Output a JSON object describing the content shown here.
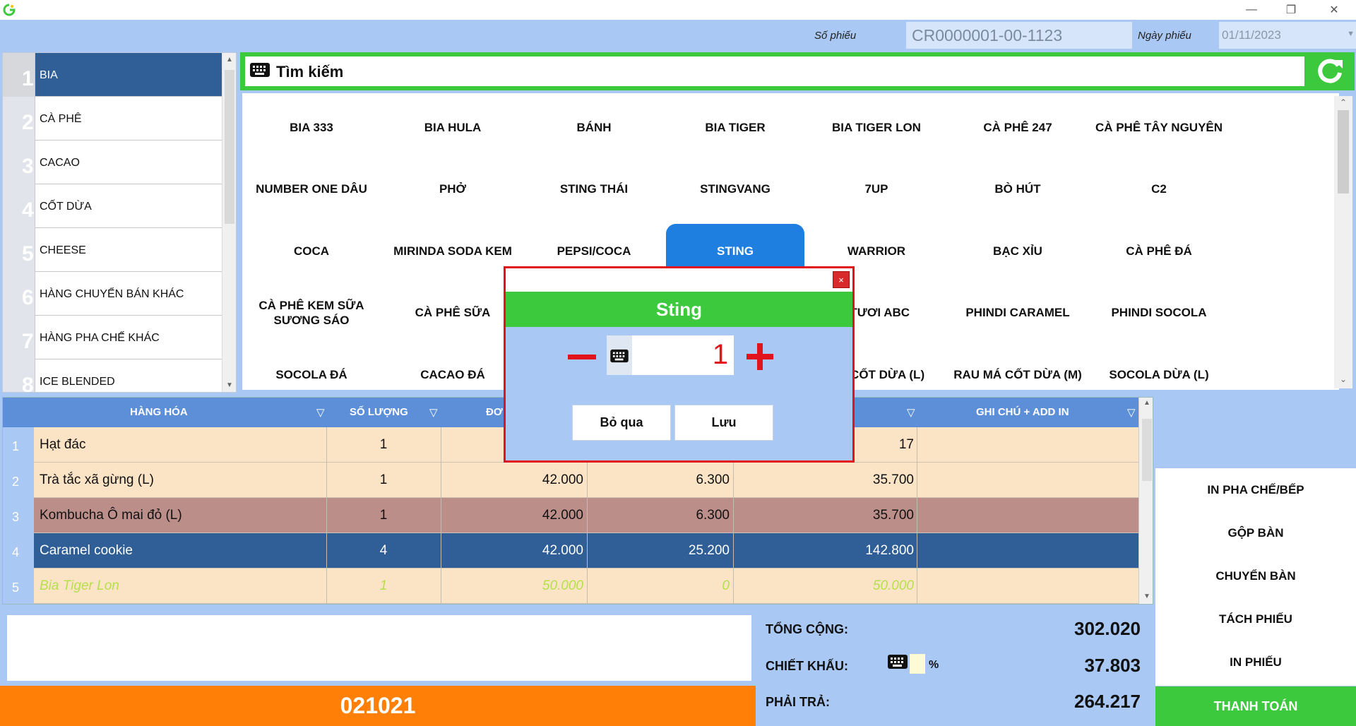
{
  "header": {
    "ticket_label": "Số phiếu",
    "ticket_no": "CR0000001-00-1123",
    "date_label": "Ngày phiếu",
    "date_value": "01/11/2023"
  },
  "categories": [
    {
      "num": "1",
      "name": "BIA"
    },
    {
      "num": "2",
      "name": "CÀ PHÊ"
    },
    {
      "num": "3",
      "name": "CACAO"
    },
    {
      "num": "4",
      "name": "CỐT DỪA"
    },
    {
      "num": "5",
      "name": "CHEESE"
    },
    {
      "num": "6",
      "name": "HÀNG CHUYỂN BÁN KHÁC"
    },
    {
      "num": "7",
      "name": "HÀNG PHA CHẾ KHÁC"
    },
    {
      "num": "8",
      "name": "ICE BLENDED"
    }
  ],
  "search": {
    "label": "Tìm kiếm"
  },
  "products": [
    "BIA 333",
    "BIA HULA",
    "BÁNH",
    "BIA TIGER",
    "BIA TIGER LON",
    "CÀ PHÊ 247",
    "CÀ PHÊ TÂY NGUYÊN",
    "NUMBER ONE DÂU",
    "PHỞ",
    "STING THÁI",
    "STINGVANG",
    "7UP",
    "BÒ HÚT",
    "C2",
    "COCA",
    "MIRINDA SODA KEM",
    "PEPSI/COCA",
    "STING",
    "WARRIOR",
    "BẠC XỈU",
    "CÀ PHÊ ĐÁ",
    "CÀ PHÊ KEM SỮA SƯƠNG SÁO",
    "CÀ PHÊ SỮA",
    "",
    "",
    "I TƯƠI ABC",
    "PHINDI CARAMEL",
    "PHINDI SOCOLA",
    "SOCOLA ĐÁ",
    "CACAO ĐÁ",
    "",
    "",
    "MÁ CỐT DỪA (L)",
    "RAU MÁ CỐT DỪA (M)",
    "SOCOLA DỪA (L)"
  ],
  "table": {
    "headers": {
      "item": "HÀNG HÓA",
      "qty": "SỐ LƯỢNG",
      "price": "ĐƠ",
      "note": "GHI CHÚ + ADD IN"
    },
    "rows": [
      {
        "num": "1",
        "item": "Hạt đác",
        "qty": "1",
        "price": "",
        "discount": "",
        "total": "17"
      },
      {
        "num": "2",
        "item": "Trà tắc xã gừng (L)",
        "qty": "1",
        "price": "42.000",
        "discount": "6.300",
        "total": "35.700"
      },
      {
        "num": "3",
        "item": "Kombucha Ô mai đỏ (L)",
        "qty": "1",
        "price": "42.000",
        "discount": "6.300",
        "total": "35.700"
      },
      {
        "num": "4",
        "item": "Caramel cookie",
        "qty": "4",
        "price": "42.000",
        "discount": "25.200",
        "total": "142.800"
      },
      {
        "num": "5",
        "item": "Bia Tiger Lon",
        "qty": "1",
        "price": "50.000",
        "discount": "0",
        "total": "50.000"
      }
    ]
  },
  "actions": [
    "IN PHA CHẾ/BẾP",
    "GỘP BÀN",
    "CHUYỂN BÀN",
    "TÁCH PHIẾU",
    "IN PHIẾU"
  ],
  "pay_label": "THANH TOÁN",
  "order_code": "021021",
  "summary": {
    "total_label": "TỔNG CỘNG:",
    "total_value": "302.020",
    "discount_label": "CHIẾT KHẤU:",
    "discount_pct_sign": "%",
    "discount_value": "37.803",
    "pay_label": "PHẢI TRẢ:",
    "pay_value": "264.217"
  },
  "modal": {
    "title": "Sting",
    "close": "×",
    "quantity": "1",
    "skip_label": "Bỏ qua",
    "save_label": "Lưu"
  },
  "colors": {
    "accent_green": "#3dc93d",
    "accent_orange": "#ff7f07",
    "selection_blue": "#2f5f96",
    "alert_red": "#e0141a"
  }
}
